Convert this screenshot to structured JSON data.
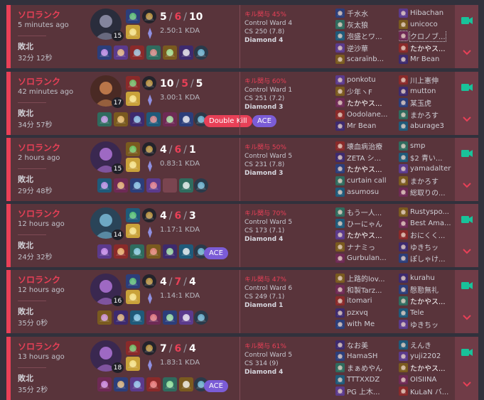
{
  "colors": {
    "loss_accent": "#e84057",
    "card_bg": "#59343b",
    "sidebar_bg": "#703c47",
    "rec_icon": "#19c29a",
    "ace_badge": "#7b5cd6",
    "double_kill_badge": "#e84057"
  },
  "icons": {
    "record": "video-camera-icon",
    "expand": "chevron-down-icon",
    "rune": "rune-icon",
    "summoner_spell": "spell-icon",
    "item": "item-icon"
  },
  "matches": [
    {
      "queue": "ソロランク",
      "ago": "5 minutes ago",
      "result": "敗北",
      "duration": "32分 12秒",
      "level": "15",
      "kills": "5",
      "deaths": "6",
      "assists": "10",
      "kda": "2.50:1 KDA",
      "kill_part": "キル関与 45%",
      "wards": "Control Ward 4",
      "cs": "CS 250 (7.8)",
      "rank": "Diamond 4",
      "badges": [],
      "champ_color": "#2a2d3c",
      "champ_accent": "#9b9bb5",
      "team1": [
        "千水水",
        "灰太狼",
        "泡盛とワ...",
        "逆沙華",
        "scaraïnb..."
      ],
      "team2": [
        "Hibachan",
        "unicoco",
        "クロノブ...",
        "たかやス...",
        "Mr Bean"
      ]
    },
    {
      "queue": "ソロランク",
      "ago": "42 minutes ago",
      "result": "敗北",
      "duration": "34分 57秒",
      "level": "17",
      "kills": "10",
      "deaths": "5",
      "assists": "5",
      "kda": "3.00:1 KDA",
      "kill_part": "キル関与 60%",
      "wards": "Control Ward 1",
      "cs": "CS 251 (7.2)",
      "rank": "Diamond 3",
      "badges": [
        "Double Kill",
        "ACE"
      ],
      "champ_color": "#4a2a24",
      "champ_accent": "#d68a52",
      "team1": [
        "ponkotu",
        "少年ヽF",
        "たかやス...",
        "Oodolane...",
        "Mr Bean"
      ],
      "team2": [
        "川上憲伸",
        "mutton",
        "某玉虎",
        "まかろす",
        "aburage3"
      ]
    },
    {
      "queue": "ソロランク",
      "ago": "2 hours ago",
      "result": "敗北",
      "duration": "29分 48秒",
      "level": "15",
      "kills": "4",
      "deaths": "6",
      "assists": "1",
      "kda": "0.83:1 KDA",
      "kill_part": "キル関与 50%",
      "wards": "Control Ward 5",
      "cs": "CS 231 (7.8)",
      "rank": "Diamond 3",
      "badges": [],
      "champ_color": "#3a2850",
      "champ_accent": "#b879e0",
      "team1": [
        "壊血病治療",
        "ZETA シ...",
        "たかやス...",
        "curtain call",
        "asumosu"
      ],
      "team2": [
        "smp",
        "$2 青い...",
        "yamadalter",
        "まかろす",
        "総取りの..."
      ]
    },
    {
      "queue": "ソロランク",
      "ago": "12 hours ago",
      "result": "敗北",
      "duration": "24分 32秒",
      "level": "14",
      "kills": "4",
      "deaths": "6",
      "assists": "3",
      "kda": "1.17:1 KDA",
      "kill_part": "キル関与 70%",
      "wards": "Control Ward 5",
      "cs": "CS 173 (7.1)",
      "rank": "Diamond 4",
      "badges": [
        "ACE"
      ],
      "champ_color": "#2a4458",
      "champ_accent": "#7fc2e0",
      "team1": [
        "もう一人...",
        "ひーにゃん",
        "たかやス...",
        "ナナミっ",
        "Gurbulan..."
      ],
      "team2": [
        "Rustyspo...",
        "Best Ama...",
        "おにくく...",
        "ゆきちッ",
        "ぽしゃけ..."
      ]
    },
    {
      "queue": "ソロランク",
      "ago": "12 hours ago",
      "result": "敗北",
      "duration": "35分 0秒",
      "level": "16",
      "kills": "4",
      "deaths": "7",
      "assists": "4",
      "kda": "1.14:1 KDA",
      "kill_part": "キル関与 47%",
      "wards": "Control Ward 6",
      "cs": "CS 249 (7.1)",
      "rank": "Diamond 1",
      "badges": [],
      "champ_color": "#3a2850",
      "champ_accent": "#b879e0",
      "team1": [
        "上路的lov...",
        "和製Tarz...",
        "itomari",
        "pzxvq",
        "with Me"
      ],
      "team2": [
        "kurahu",
        "慇懃無礼",
        "たかやス...",
        "Tele",
        "ゆきちッ"
      ]
    },
    {
      "queue": "ソロランク",
      "ago": "13 hours ago",
      "result": "敗北",
      "duration": "35分 2秒",
      "level": "18",
      "kills": "7",
      "deaths": "6",
      "assists": "4",
      "kda": "1.83:1 KDA",
      "kill_part": "キル関与 61%",
      "wards": "Control Ward 5",
      "cs": "CS 314 (9)",
      "rank": "Diamond 4",
      "badges": [
        "ACE"
      ],
      "champ_color": "#3a2850",
      "champ_accent": "#b879e0",
      "team1": [
        "なお美",
        "HamaSH",
        "まぁめやん",
        "TTTXXDZ",
        "PG 上木..."
      ],
      "team2": [
        "えんき",
        "yuji2202",
        "たかやス...",
        "OISIINA",
        "KuLaN バ..."
      ]
    }
  ]
}
